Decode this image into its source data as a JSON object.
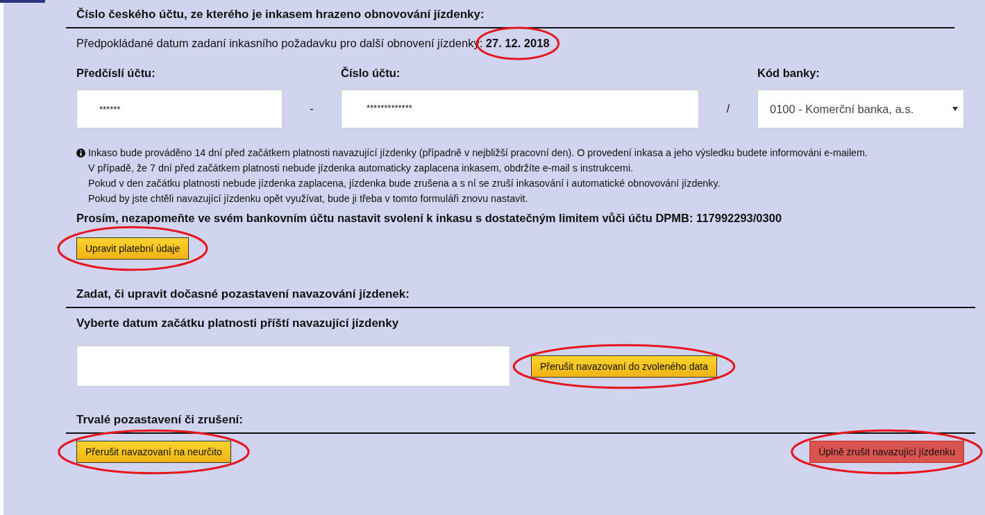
{
  "account_section": {
    "title": "Číslo českého účtu, ze kterého je inkasem hrazeno obnovování jízdenky:",
    "expected_date": {
      "label": "Předpokládané datum zadaní inkasního požadavku pro další obnovení jízdenky:",
      "value": "27. 12. 2018",
      "circled": true
    },
    "prefix": {
      "label": "Předčíslí účtu:",
      "value": "******"
    },
    "separator_1": "-",
    "number": {
      "label": "Číslo účtu:",
      "value": "*************"
    },
    "separator_2": "/",
    "bank": {
      "label": "Kód banky:",
      "value": "0100 - Komerční banka, a.s."
    },
    "info_lines": [
      "Inkaso bude prováděno 14 dní před začátkem platnosti navazující jízdenky (případně v nejbližší pracovní den). O provedení inkasa a jeho výsledku budete informováni e-mailem.",
      "V případě, že 7 dní před začátkem platnosti nebude jízdenka automaticky zaplacena inkasem, obdržíte e-mail s instrukcemi.",
      "Pokud v den začátku platnosti nebude jízdenka zaplacena, jízdenka bude zrušena a s ní se zruší inkasování i automatické obnovování jízdenky.",
      "Pokud by jste chtěli navazující jízdenku opět využívat, bude ji třeba v tomto formuláři znovu nastavit."
    ],
    "notice": "Prosím, nezapomeňte ve svém bankovním účtu nastavit svolení k inkasu s dostatečným limitem vůči účtu DPMB: **117992293/0300**",
    "button": {
      "label": "Upravit platební údaje",
      "kind": "warning",
      "circled": true
    }
  },
  "pause_section": {
    "title": "Zadat, či upravit dočasné pozastavení navazování jízdenek:",
    "subtitle": "Vyberte datum začátku platnosti příští navazující jízdenky",
    "button": {
      "label": "Přerušit navazovaní do zvoleného data",
      "kind": "warning",
      "circled": true
    }
  },
  "cancel_section": {
    "title": "Trvalé pozastavení či zrušení:",
    "buttons": [
      {
        "label": "Přerušit navazovaní na neurčito",
        "kind": "warning",
        "circled": true
      },
      {
        "label": "Úplně zrušit navazující jízdenku",
        "kind": "danger",
        "circled": true
      }
    ]
  }
}
